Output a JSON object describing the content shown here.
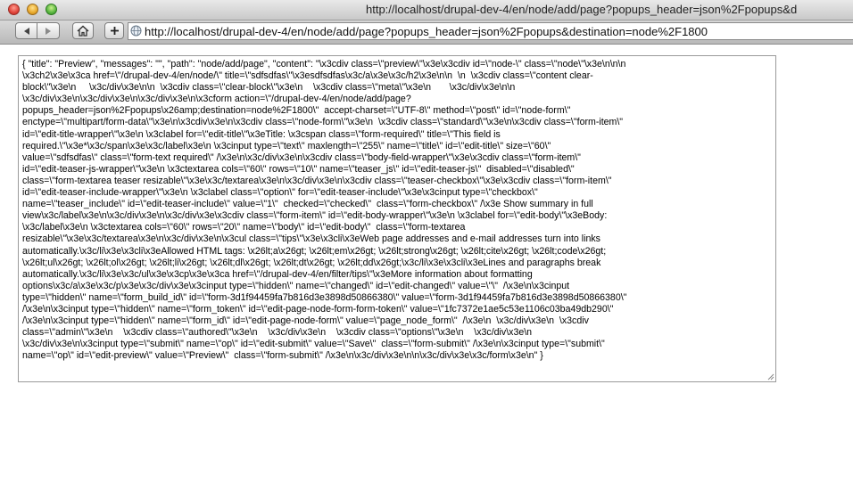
{
  "window": {
    "title": "http://localhost/drupal-dev-4/en/node/add/page?popups_header=json%2Fpopups&d"
  },
  "toolbar": {
    "back_icon": "back-arrow-icon",
    "forward_icon": "forward-arrow-icon",
    "home_icon": "home-icon",
    "add_icon": "plus-icon",
    "address": "http://localhost/drupal-dev-4/en/node/add/page?popups_header=json%2Fpopups&destination=node%2F1800"
  },
  "content": {
    "lines": [
      "{ \"title\": \"Preview\", \"messages\": \"\", \"path\": \"node/add/page\", \"content\": \"\\x3cdiv class=\\\"preview\\\"\\x3e\\x3cdiv id=\\\"node-\\\" class=\\\"node\\\"\\x3e\\n\\n\\n",
      "\\x3ch2\\x3e\\x3ca href=\\\"/drupal-dev-4/en/node/\\\" title=\\\"sdfsdfas\\\"\\x3esdfsdfas\\x3c/a\\x3e\\x3c/h2\\x3e\\n\\n  \\n  \\x3cdiv class=\\\"content clear-",
      "block\\\"\\x3e\\n     \\x3c/div\\x3e\\n\\n  \\x3cdiv class=\\\"clear-block\\\"\\x3e\\n    \\x3cdiv class=\\\"meta\\\"\\x3e\\n       \\x3c/div\\x3e\\n\\n",
      "\\x3c/div\\x3e\\n\\x3c/div\\x3e\\n\\x3c/div\\x3e\\n\\x3cform action=\\\"/drupal-dev-4/en/node/add/page?",
      "popups_header=json%2Fpopups\\x26amp;destination=node%2F1800\\\"  accept-charset=\\\"UTF-8\\\" method=\\\"post\\\" id=\\\"node-form\\\"",
      "enctype=\\\"multipart/form-data\\\"\\x3e\\n\\x3cdiv\\x3e\\n\\x3cdiv class=\\\"node-form\\\"\\x3e\\n  \\x3cdiv class=\\\"standard\\\"\\x3e\\n\\x3cdiv class=\\\"form-item\\\"",
      "id=\\\"edit-title-wrapper\\\"\\x3e\\n \\x3clabel for=\\\"edit-title\\\"\\x3eTitle: \\x3cspan class=\\\"form-required\\\" title=\\\"This field is",
      "required.\\\"\\x3e*\\x3c/span\\x3e\\x3c/label\\x3e\\n \\x3cinput type=\\\"text\\\" maxlength=\\\"255\\\" name=\\\"title\\\" id=\\\"edit-title\\\" size=\\\"60\\\"",
      "value=\\\"sdfsdfas\\\" class=\\\"form-text required\\\" /\\x3e\\n\\x3c/div\\x3e\\n\\x3cdiv class=\\\"body-field-wrapper\\\"\\x3e\\x3cdiv class=\\\"form-item\\\"",
      "id=\\\"edit-teaser-js-wrapper\\\"\\x3e\\n \\x3ctextarea cols=\\\"60\\\" rows=\\\"10\\\" name=\\\"teaser_js\\\" id=\\\"edit-teaser-js\\\"  disabled=\\\"disabled\\\"",
      "class=\\\"form-textarea teaser resizable\\\"\\x3e\\x3c/textarea\\x3e\\n\\x3c/div\\x3e\\n\\x3cdiv class=\\\"teaser-checkbox\\\"\\x3e\\x3cdiv class=\\\"form-item\\\"",
      "id=\\\"edit-teaser-include-wrapper\\\"\\x3e\\n \\x3clabel class=\\\"option\\\" for=\\\"edit-teaser-include\\\"\\x3e\\x3cinput type=\\\"checkbox\\\"",
      "name=\\\"teaser_include\\\" id=\\\"edit-teaser-include\\\" value=\\\"1\\\"  checked=\\\"checked\\\"  class=\\\"form-checkbox\\\" /\\x3e Show summary in full",
      "view\\x3c/label\\x3e\\n\\x3c/div\\x3e\\n\\x3c/div\\x3e\\x3cdiv class=\\\"form-item\\\" id=\\\"edit-body-wrapper\\\"\\x3e\\n \\x3clabel for=\\\"edit-body\\\"\\x3eBody:",
      "\\x3c/label\\x3e\\n \\x3ctextarea cols=\\\"60\\\" rows=\\\"20\\\" name=\\\"body\\\" id=\\\"edit-body\\\"  class=\\\"form-textarea",
      "resizable\\\"\\x3e\\x3c/textarea\\x3e\\n\\x3c/div\\x3e\\n\\x3cul class=\\\"tips\\\"\\x3e\\x3cli\\x3eWeb page addresses and e-mail addresses turn into links",
      "automatically.\\x3c/li\\x3e\\x3cli\\x3eAllowed HTML tags: \\x26lt;a\\x26gt; \\x26lt;em\\x26gt; \\x26lt;strong\\x26gt; \\x26lt;cite\\x26gt; \\x26lt;code\\x26gt;",
      "\\x26lt;ul\\x26gt; \\x26lt;ol\\x26gt; \\x26lt;li\\x26gt; \\x26lt;dl\\x26gt; \\x26lt;dt\\x26gt; \\x26lt;dd\\x26gt;\\x3c/li\\x3e\\x3cli\\x3eLines and paragraphs break",
      "automatically.\\x3c/li\\x3e\\x3c/ul\\x3e\\x3cp\\x3e\\x3ca href=\\\"/drupal-dev-4/en/filter/tips\\\"\\x3eMore information about formatting",
      "options\\x3c/a\\x3e\\x3c/p\\x3e\\x3c/div\\x3e\\x3cinput type=\\\"hidden\\\" name=\\\"changed\\\" id=\\\"edit-changed\\\" value=\\\"\\\"  /\\x3e\\n\\x3cinput",
      "type=\\\"hidden\\\" name=\\\"form_build_id\\\" id=\\\"form-3d1f94459fa7b816d3e3898d50866380\\\" value=\\\"form-3d1f94459fa7b816d3e3898d50866380\\\"",
      "/\\x3e\\n\\x3cinput type=\\\"hidden\\\" name=\\\"form_token\\\" id=\\\"edit-page-node-form-form-token\\\" value=\\\"1fc7372e1ae5c53e1106c03ba49db290\\\"",
      "/\\x3e\\n\\x3cinput type=\\\"hidden\\\" name=\\\"form_id\\\" id=\\\"edit-page-node-form\\\" value=\\\"page_node_form\\\"  /\\x3e\\n  \\x3c/div\\x3e\\n  \\x3cdiv",
      "class=\\\"admin\\\"\\x3e\\n    \\x3cdiv class=\\\"authored\\\"\\x3e\\n    \\x3c/div\\x3e\\n    \\x3cdiv class=\\\"options\\\"\\x3e\\n    \\x3c/div\\x3e\\n",
      "\\x3c/div\\x3e\\n\\x3cinput type=\\\"submit\\\" name=\\\"op\\\" id=\\\"edit-submit\\\" value=\\\"Save\\\"  class=\\\"form-submit\\\" /\\x3e\\n\\x3cinput type=\\\"submit\\\"",
      "name=\\\"op\\\" id=\\\"edit-preview\\\" value=\\\"Preview\\\"  class=\\\"form-submit\\\" /\\x3e\\n\\x3c/div\\x3e\\n\\n\\x3c/div\\x3e\\x3c/form\\x3e\\n\" }"
    ]
  }
}
